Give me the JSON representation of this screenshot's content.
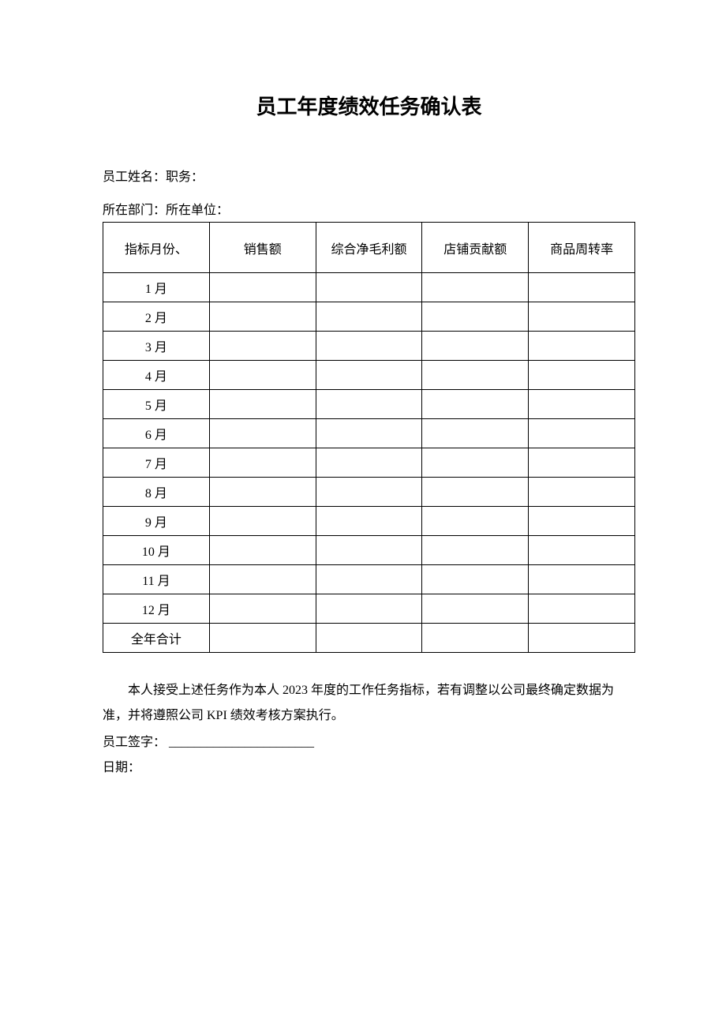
{
  "title": "员工年度绩效任务确认表",
  "info": {
    "line1": "员工姓名：职务：",
    "line2": "所在部门：所在单位："
  },
  "table": {
    "headers": [
      "指标月份、",
      "销售额",
      "综合净毛利额",
      "店铺贡献额",
      "商品周转率"
    ],
    "rows": [
      [
        "1 月",
        "",
        "",
        "",
        ""
      ],
      [
        "2 月",
        "",
        "",
        "",
        ""
      ],
      [
        "3 月",
        "",
        "",
        "",
        ""
      ],
      [
        "4 月",
        "",
        "",
        "",
        ""
      ],
      [
        "5 月",
        "",
        "",
        "",
        ""
      ],
      [
        "6 月",
        "",
        "",
        "",
        ""
      ],
      [
        "7 月",
        "",
        "",
        "",
        ""
      ],
      [
        "8 月",
        "",
        "",
        "",
        ""
      ],
      [
        "9 月",
        "",
        "",
        "",
        ""
      ],
      [
        "10 月",
        "",
        "",
        "",
        ""
      ],
      [
        "11 月",
        "",
        "",
        "",
        ""
      ],
      [
        "12 月",
        "",
        "",
        "",
        ""
      ],
      [
        "全年合计",
        "",
        "",
        "",
        ""
      ]
    ]
  },
  "statement": "本人接受上述任务作为本人 2023 年度的工作任务指标，若有调整以公司最终确定数据为准，并将遵照公司 KPI 绩效考核方案执行。",
  "signature": {
    "label": "员工签字：",
    "line": "_______________________"
  },
  "date": {
    "label": "日期："
  }
}
